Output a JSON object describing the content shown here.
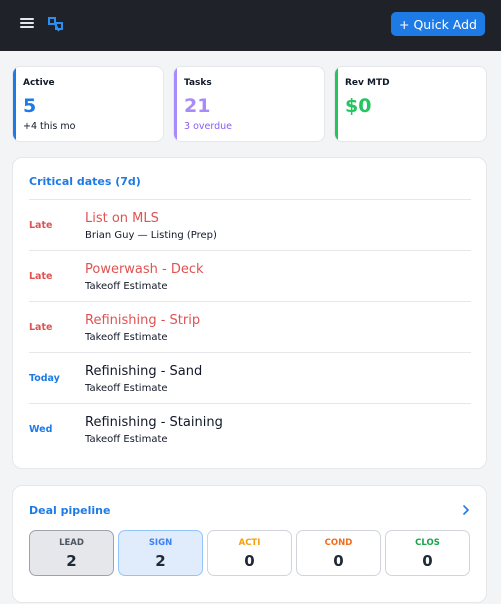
{
  "header": {
    "menu_icon": "hamburger-menu-icon",
    "logo_icon": "app-logo-icon",
    "quick_add_label": "+ Quick Add"
  },
  "stats": [
    {
      "label": "Active",
      "value": "5",
      "sub": "+4 this mo",
      "accent": "#1e7be6",
      "sub_color": "#111827"
    },
    {
      "label": "Tasks",
      "value": "21",
      "sub": "3 overdue",
      "accent": "#a78bfa",
      "sub_color": "#8b5cf6"
    },
    {
      "label": "Rev MTD",
      "value": "$0",
      "sub": "",
      "accent": "#22c55e",
      "sub_color": "#111827"
    }
  ],
  "critical": {
    "title": "Critical dates (7d)",
    "items": [
      {
        "when": "Late",
        "title": "List on MLS",
        "sub": "Brian Guy — Listing (Prep)",
        "status": "late"
      },
      {
        "when": "Late",
        "title": "Powerwash - Deck",
        "sub": "Takeoff Estimate",
        "status": "late"
      },
      {
        "when": "Late",
        "title": "Refinishing - Strip",
        "sub": "Takeoff Estimate",
        "status": "late"
      },
      {
        "when": "Today",
        "title": "Refinishing - Sand",
        "sub": "Takeoff Estimate",
        "status": "today"
      },
      {
        "when": "Wed",
        "title": "Refinishing - Staining",
        "sub": "Takeoff Estimate",
        "status": "upcoming"
      }
    ]
  },
  "pipeline": {
    "title": "Deal pipeline",
    "chevron_icon": "chevron-right-icon",
    "stages": [
      {
        "label": "LEAD",
        "count": "2",
        "color": "#4b5563",
        "bg": "#e5e7eb",
        "border": "#9ca3af"
      },
      {
        "label": "SIGN",
        "count": "2",
        "color": "#3b82f6",
        "bg": "#e0ebfb",
        "border": "#93c5fd"
      },
      {
        "label": "ACTI",
        "count": "0",
        "color": "#f59e0b",
        "bg": "#ffffff",
        "border": "#d1d5db"
      },
      {
        "label": "COND",
        "count": "0",
        "color": "#ef6c1a",
        "bg": "#ffffff",
        "border": "#d1d5db"
      },
      {
        "label": "CLOS",
        "count": "0",
        "color": "#16a34a",
        "bg": "#ffffff",
        "border": "#d1d5db"
      }
    ]
  },
  "colors": {
    "late": "#e05252",
    "today": "#1e7be6",
    "upcoming": "#1e7be6",
    "accent": "#1e7be6",
    "topbar": "#1f2329"
  }
}
